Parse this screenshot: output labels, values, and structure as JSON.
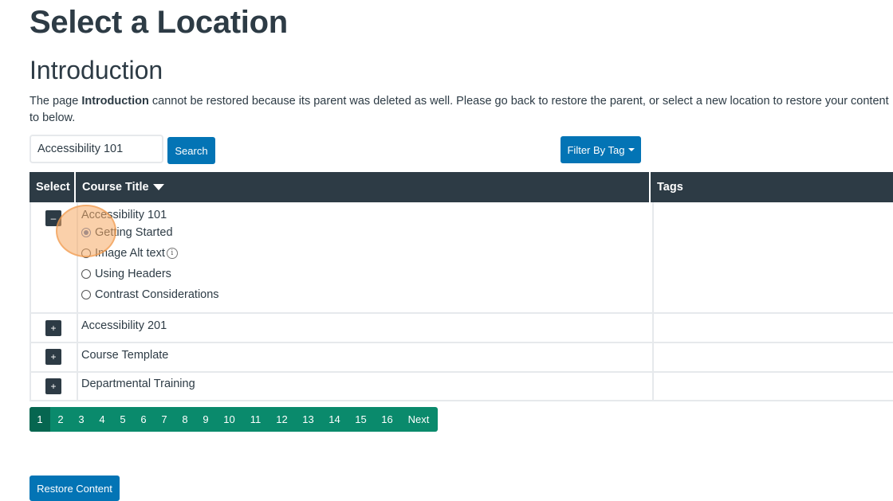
{
  "header": {
    "title": "Select a Location",
    "section": "Introduction"
  },
  "message": {
    "prefix": "The page ",
    "page_name": "Introduction",
    "suffix": " cannot be restored because its parent was deleted as well. Please go back to restore the parent, or select a new location to restore your content to below."
  },
  "search": {
    "value": "Accessibility 101",
    "button_label": "Search"
  },
  "filter": {
    "label": "Filter By Tag"
  },
  "table": {
    "headers": {
      "select": "Select",
      "title": "Course Title",
      "tags": "Tags"
    },
    "expanded_course": {
      "toggle": "–",
      "name": "Accessibility 101",
      "pages": [
        {
          "label": "Getting Started",
          "selected": true
        },
        {
          "label": "Image Alt text",
          "selected": false,
          "info_icon": "info-icon"
        },
        {
          "label": "Using Headers",
          "selected": false
        },
        {
          "label": "Contrast Considerations",
          "selected": false
        }
      ]
    },
    "collapsed_courses": [
      {
        "toggle": "+",
        "name": "Accessibility 201"
      },
      {
        "toggle": "+",
        "name": "Course Template"
      },
      {
        "toggle": "+",
        "name": "Departmental Training"
      }
    ]
  },
  "pagination": {
    "pages": [
      "1",
      "2",
      "3",
      "4",
      "5",
      "6",
      "7",
      "8",
      "9",
      "10",
      "11",
      "12",
      "13",
      "14",
      "15",
      "16"
    ],
    "current": "1",
    "next_label": "Next"
  },
  "restore_button": "Restore Content",
  "colors": {
    "primary": "#0374b5",
    "header_bg": "#2d3b45",
    "pager_bg": "#0a8a6c"
  }
}
